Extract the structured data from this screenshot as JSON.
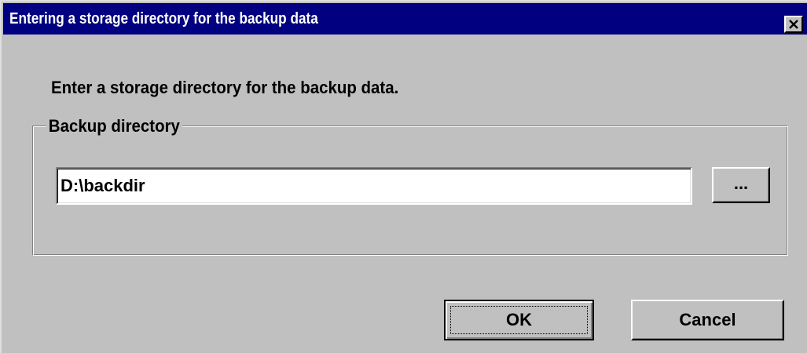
{
  "window": {
    "title": "Entering a storage directory for the backup data"
  },
  "dialog": {
    "prompt": "Enter a storage directory for the backup data.",
    "group_label": "Backup directory",
    "directory_value": "D:\\backdir",
    "browse_label": "...",
    "ok_label": "OK",
    "cancel_label": "Cancel"
  },
  "icons": {
    "close": "close-icon"
  }
}
